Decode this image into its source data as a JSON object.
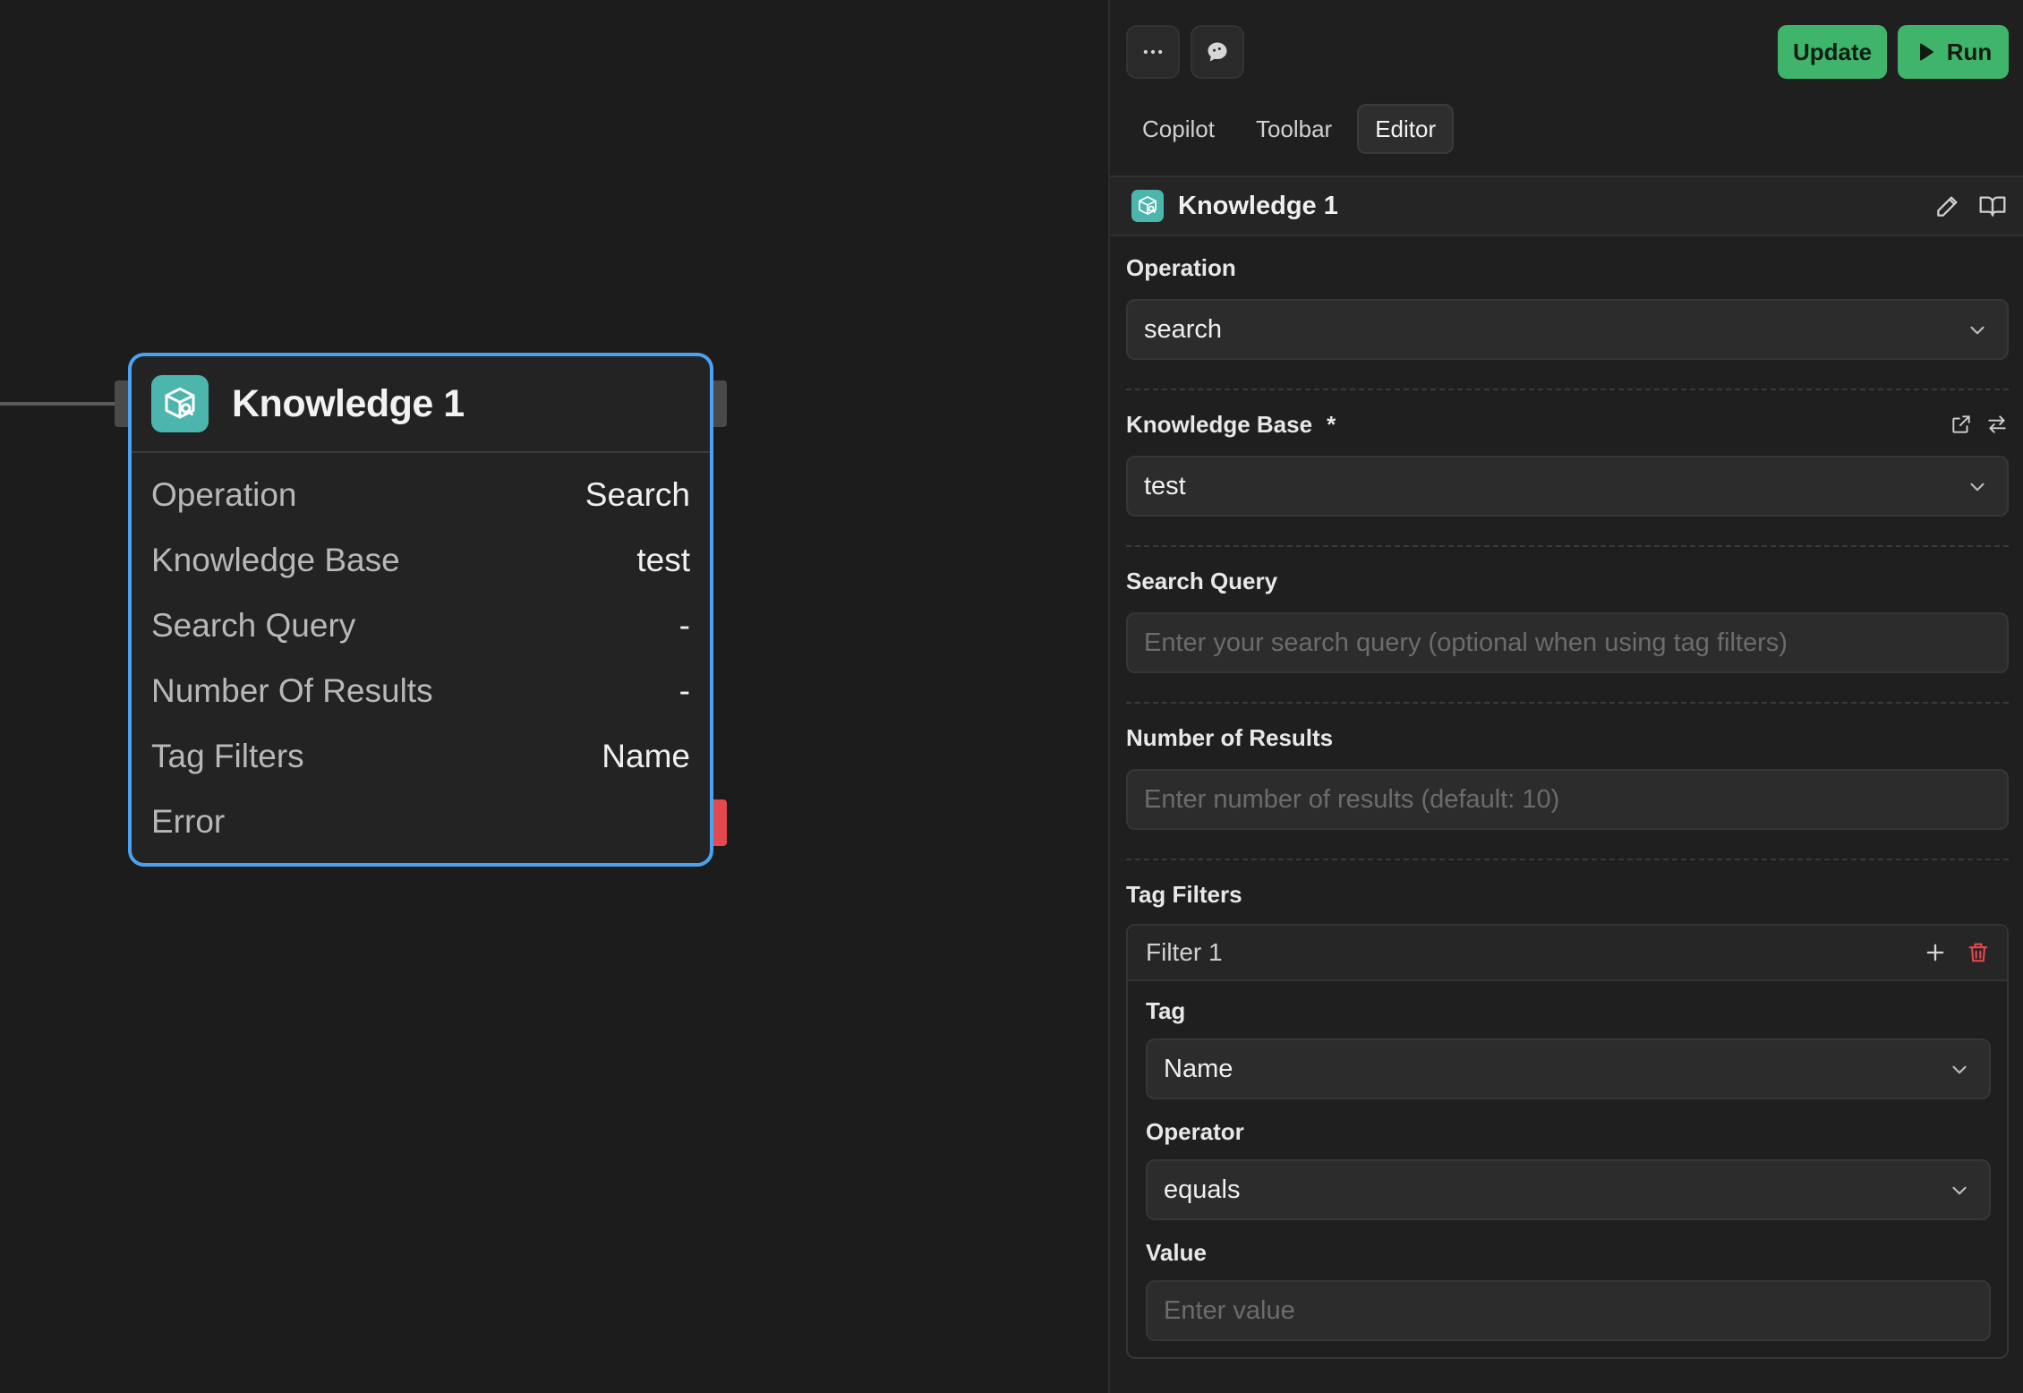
{
  "node": {
    "title": "Knowledge 1",
    "icon": "knowledge-cube-search-icon",
    "accent": "#4aa3f0",
    "icon_bg": "#4cb5ae",
    "rows": [
      {
        "label": "Operation",
        "value": "Search"
      },
      {
        "label": "Knowledge Base",
        "value": "test"
      },
      {
        "label": "Search Query",
        "value": "-"
      },
      {
        "label": "Number Of Results",
        "value": "-"
      },
      {
        "label": "Tag Filters",
        "value": "Name"
      },
      {
        "label": "Error",
        "value": ""
      }
    ]
  },
  "toolbar": {
    "more_icon": "more-horizontal-icon",
    "chat_icon": "chat-bubble-icon",
    "update_label": "Update",
    "run_label": "Run",
    "green": "#3fb56b"
  },
  "tabs": [
    {
      "label": "Copilot",
      "active": false
    },
    {
      "label": "Toolbar",
      "active": false
    },
    {
      "label": "Editor",
      "active": true
    }
  ],
  "editor": {
    "block_title": "Knowledge 1",
    "operation": {
      "label": "Operation",
      "value": "search"
    },
    "knowledge_base": {
      "label": "Knowledge Base",
      "required_mark": "*",
      "value": "test"
    },
    "search_query": {
      "label": "Search Query",
      "placeholder": "Enter your search query (optional when using tag filters)"
    },
    "num_results": {
      "label": "Number of Results",
      "placeholder": "Enter number of results (default: 10)"
    },
    "tag_filters": {
      "label": "Tag Filters",
      "filter_title": "Filter 1",
      "tag": {
        "label": "Tag",
        "value": "Name"
      },
      "operator": {
        "label": "Operator",
        "value": "equals"
      },
      "value": {
        "label": "Value",
        "placeholder": "Enter value"
      }
    }
  }
}
